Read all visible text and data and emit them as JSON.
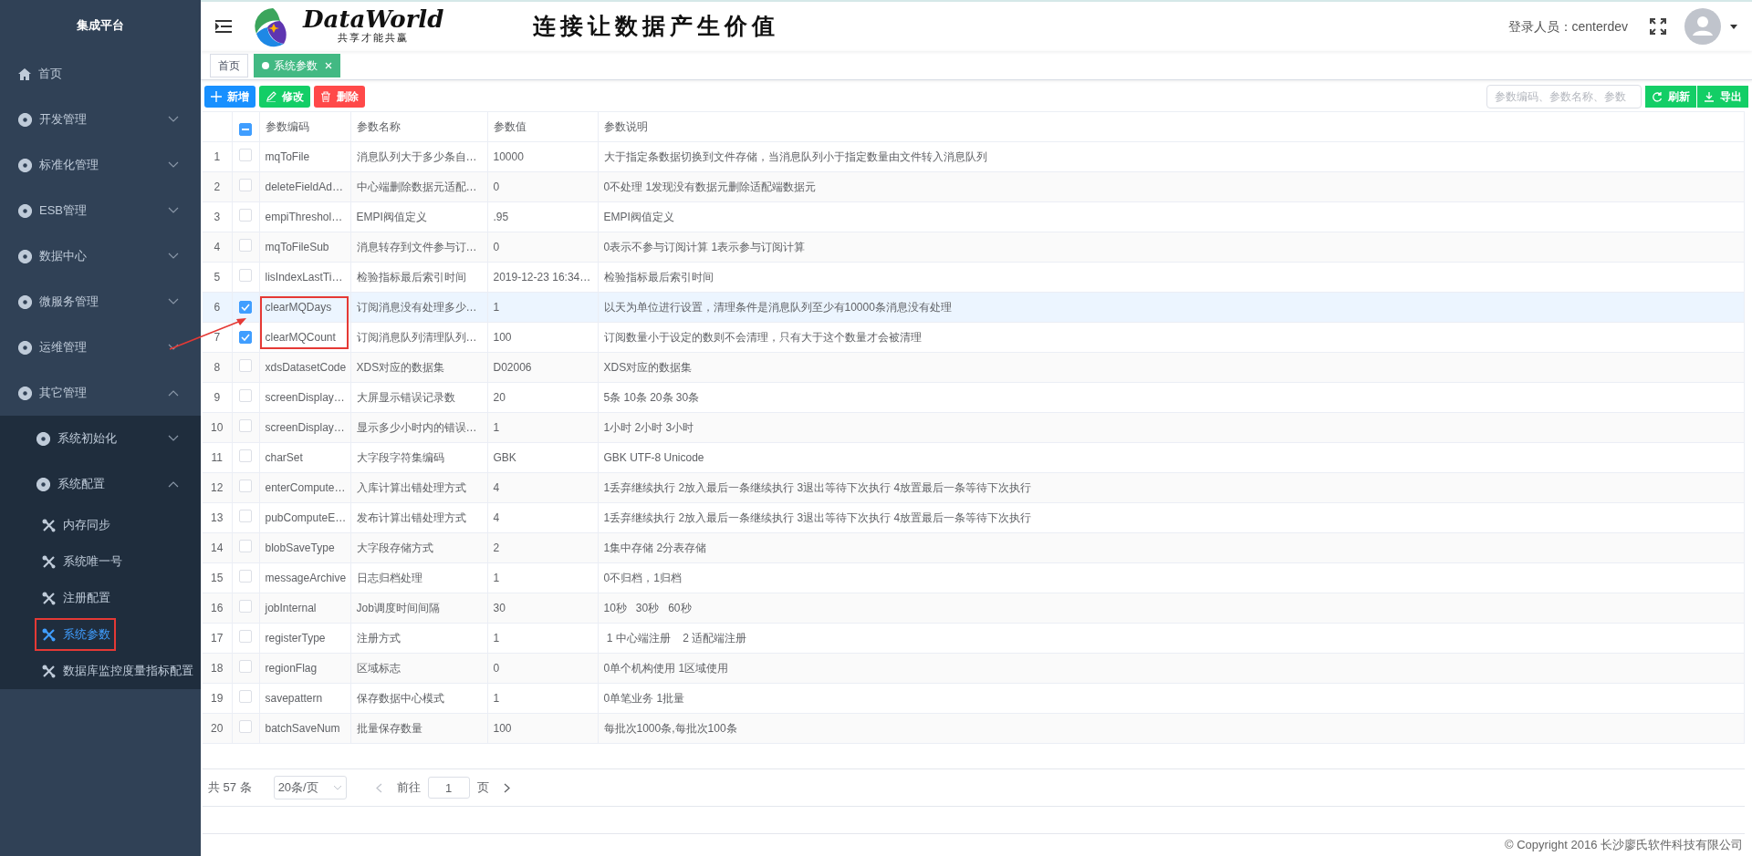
{
  "sidebar": {
    "title": "集成平台",
    "items": [
      {
        "kind": "page",
        "label": "首页",
        "boxed": false
      },
      {
        "kind": "group",
        "label": "开发管理",
        "expanded": false
      },
      {
        "kind": "group",
        "label": "标准化管理",
        "expanded": false
      },
      {
        "kind": "group",
        "label": "ESB管理",
        "expanded": false
      },
      {
        "kind": "group",
        "label": "数据中心",
        "expanded": false
      },
      {
        "kind": "group",
        "label": "微服务管理",
        "expanded": false
      },
      {
        "kind": "group",
        "label": "运维管理",
        "expanded": false
      },
      {
        "kind": "group",
        "label": "其它管理",
        "expanded": true,
        "children": [
          {
            "kind": "group",
            "label": "系统初始化",
            "expanded": false
          },
          {
            "kind": "group",
            "label": "系统配置",
            "expanded": true,
            "children": [
              {
                "kind": "leaf",
                "label": "内存同步",
                "selected": false,
                "boxed": false
              },
              {
                "kind": "leaf",
                "label": "系统唯一号",
                "selected": false,
                "boxed": false
              },
              {
                "kind": "leaf",
                "label": "注册配置",
                "selected": false,
                "boxed": false
              },
              {
                "kind": "leaf",
                "label": "系统参数",
                "selected": true,
                "boxed": true
              },
              {
                "kind": "leaf",
                "label": "数据库监控度量指标配置",
                "selected": false,
                "boxed": false
              }
            ]
          }
        ]
      }
    ]
  },
  "header": {
    "brand": {
      "name": "DataWorld",
      "motto": "共享才能共赢"
    },
    "slogan": "连接让数据产生价值",
    "user": "登录人员：centerdev"
  },
  "tabs": [
    {
      "label": "首页",
      "selected": false,
      "closable": false
    },
    {
      "label": "系统参数",
      "selected": true,
      "closable": true
    }
  ],
  "toolbar": {
    "buttons": [
      {
        "kind": "add",
        "label": "新增"
      },
      {
        "kind": "edit",
        "label": "修改"
      },
      {
        "kind": "delete",
        "label": "删除"
      }
    ],
    "search": {
      "placeholder": "参数编码、参数名称、参数"
    },
    "actions": [
      {
        "kind": "refresh",
        "label": "刷新"
      },
      {
        "kind": "export",
        "label": "导出"
      }
    ]
  },
  "table": {
    "select_all": {
      "indeterminate": true
    },
    "columns": [
      "参数编码",
      "参数名称",
      "参数值",
      "参数说明"
    ],
    "rows": [
      {
        "index": "1",
        "checked": false,
        "current": false,
        "boxed": false,
        "code": "mqToFile",
        "name": "消息队列大于多少条自…",
        "value": "10000",
        "description": "大于指定条数据切换到文件存储，当消息队列小于指定数量由文件转入消息队列"
      },
      {
        "index": "2",
        "checked": false,
        "current": false,
        "boxed": false,
        "code": "deleteFieldAd…",
        "name": "中心端删除数据元适配…",
        "value": "0",
        "description": "0不处理 1发现没有数据元删除适配端数据元"
      },
      {
        "index": "3",
        "checked": false,
        "current": false,
        "boxed": false,
        "code": "empiThreshol…",
        "name": "EMPI阀值定义",
        "value": ".95",
        "description": "EMPI阀值定义"
      },
      {
        "index": "4",
        "checked": false,
        "current": false,
        "boxed": false,
        "code": "mqToFileSub",
        "name": "消息转存到文件参与订…",
        "value": "0",
        "description": "0表示不参与订阅计算 1表示参与订阅计算"
      },
      {
        "index": "5",
        "checked": false,
        "current": false,
        "boxed": false,
        "code": "lisIndexLastTi…",
        "name": "检验指标最后索引时间",
        "value": "2019-12-23 16:34…",
        "description": "检验指标最后索引时间"
      },
      {
        "index": "6",
        "checked": true,
        "current": true,
        "boxed": true,
        "code": "clearMQDays",
        "name": "订阅消息没有处理多少…",
        "value": "1",
        "description": "以天为单位进行设置，清理条件是消息队列至少有10000条消息没有处理"
      },
      {
        "index": "7",
        "checked": true,
        "current": false,
        "boxed": true,
        "code": "clearMQCount",
        "name": "订阅消息队列清理队列…",
        "value": "100",
        "description": "订阅数量小于设定的数则不会清理，只有大于这个数量才会被清理"
      },
      {
        "index": "8",
        "checked": false,
        "current": false,
        "boxed": false,
        "code": "xdsDatasetCode",
        "name": "XDS对应的数据集",
        "value": "D02006",
        "description": "XDS对应的数据集"
      },
      {
        "index": "9",
        "checked": false,
        "current": false,
        "boxed": false,
        "code": "screenDisplay…",
        "name": "大屏显示错误记录数",
        "value": "20",
        "description": "5条 10条 20条 30条"
      },
      {
        "index": "10",
        "checked": false,
        "current": false,
        "boxed": false,
        "code": "screenDisplay…",
        "name": "显示多少小时内的错误…",
        "value": "1",
        "description": "1小时 2小时 3小时"
      },
      {
        "index": "11",
        "checked": false,
        "current": false,
        "boxed": false,
        "code": "charSet",
        "name": "大字段字符集编码",
        "value": "GBK",
        "description": "GBK UTF-8 Unicode"
      },
      {
        "index": "12",
        "checked": false,
        "current": false,
        "boxed": false,
        "code": "enterCompute…",
        "name": "入库计算出错处理方式",
        "value": "4",
        "description": "1丢弃继续执行 2放入最后一条继续执行 3退出等待下次执行 4放置最后一条等待下次执行"
      },
      {
        "index": "13",
        "checked": false,
        "current": false,
        "boxed": false,
        "code": "pubComputeE…",
        "name": "发布计算出错处理方式",
        "value": "4",
        "description": "1丢弃继续执行 2放入最后一条继续执行 3退出等待下次执行 4放置最后一条等待下次执行"
      },
      {
        "index": "14",
        "checked": false,
        "current": false,
        "boxed": false,
        "code": "blobSaveType",
        "name": "大字段存储方式",
        "value": "2",
        "description": "1集中存储 2分表存储"
      },
      {
        "index": "15",
        "checked": false,
        "current": false,
        "boxed": false,
        "code": "messageArchive",
        "name": "日志归档处理",
        "value": "1",
        "description": "0不归档，1归档"
      },
      {
        "index": "16",
        "checked": false,
        "current": false,
        "boxed": false,
        "code": "jobInternal",
        "name": "Job调度时间间隔",
        "value": "30",
        "description": "10秒   30秒   60秒"
      },
      {
        "index": "17",
        "checked": false,
        "current": false,
        "boxed": false,
        "code": "registerType",
        "name": "注册方式",
        "value": "1",
        "description": " 1 中心端注册    2 适配端注册"
      },
      {
        "index": "18",
        "checked": false,
        "current": false,
        "boxed": false,
        "code": "regionFlag",
        "name": "区域标志",
        "value": "0",
        "description": "0单个机构使用 1区域使用"
      },
      {
        "index": "19",
        "checked": false,
        "current": false,
        "boxed": false,
        "code": "savepattern",
        "name": "保存数据中心模式",
        "value": "1",
        "description": "0单笔业务 1批量"
      },
      {
        "index": "20",
        "checked": false,
        "current": false,
        "boxed": false,
        "code": "batchSaveNum",
        "name": "批量保存数量",
        "value": "100",
        "description": "每批次1000条,每批次100条"
      }
    ]
  },
  "pagination": {
    "total": "共 57 条",
    "page_size": "20条/页",
    "goto_label": "前往",
    "page": "1",
    "page_suffix": "页"
  },
  "footer": "© Copyright 2016 长沙廖氏软件科技有限公司"
}
